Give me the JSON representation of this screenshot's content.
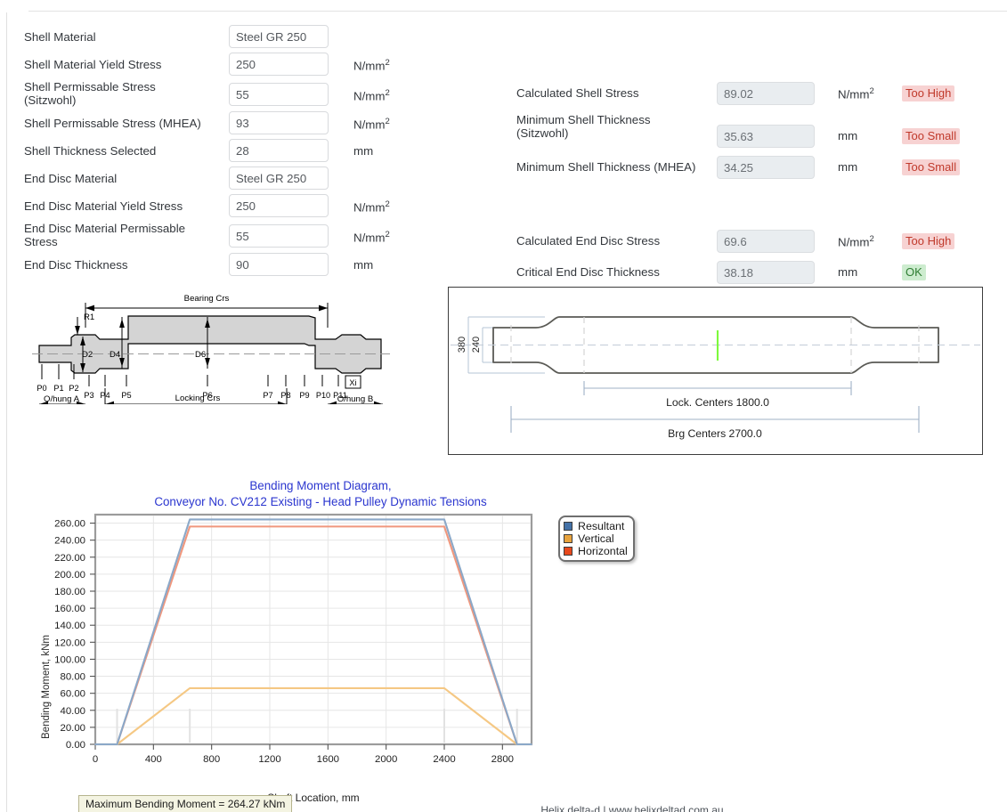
{
  "form_left": {
    "rows": [
      {
        "label": "Shell Material",
        "value": "Steel GR 250",
        "unit": "",
        "unit_sup": "",
        "tall": false
      },
      {
        "label": "Shell Material Yield Stress",
        "value": "250",
        "unit": "N/mm",
        "unit_sup": "2",
        "tall": false
      },
      {
        "label": "Shell Permissable Stress (Sitzwohl)",
        "value": "55",
        "unit": "N/mm",
        "unit_sup": "2",
        "tall": true
      },
      {
        "label": "Shell Permissable Stress (MHEA)",
        "value": "93",
        "unit": "N/mm",
        "unit_sup": "2",
        "tall": false
      },
      {
        "label": "Shell Thickness Selected",
        "value": "28",
        "unit": "mm",
        "unit_sup": "",
        "tall": false
      },
      {
        "label": "End Disc Material",
        "value": "Steel GR 250",
        "unit": "",
        "unit_sup": "",
        "tall": false
      },
      {
        "label": "End Disc Material Yield Stress",
        "value": "250",
        "unit": "N/mm",
        "unit_sup": "2",
        "tall": false
      },
      {
        "label": "End Disc Material Permissable Stress",
        "value": "55",
        "unit": "N/mm",
        "unit_sup": "2",
        "tall": true
      },
      {
        "label": "End Disc Thickness",
        "value": "90",
        "unit": "mm",
        "unit_sup": "",
        "tall": false
      }
    ],
    "label_line_breaks": {
      "shell_permissable_sitzwohl": [
        "Shell Permissable Stress",
        "(Sitzwohl)"
      ],
      "end_disc_permissable": [
        "End Disc Material Permissable",
        "Stress"
      ]
    }
  },
  "results_right": {
    "rows": [
      {
        "label": "Calculated Shell Stress",
        "value": "89.02",
        "unit": "N/mm",
        "unit_sup": "2",
        "status": "Too High",
        "status_kind": "bad",
        "tall": false,
        "gap_before": false
      },
      {
        "label": "Minimum Shell Thickness (Sitzwohl)",
        "value": "35.63",
        "unit": "mm",
        "unit_sup": "",
        "status": "Too Small",
        "status_kind": "bad",
        "tall": true,
        "gap_before": false
      },
      {
        "label": "Minimum Shell Thickness (MHEA)",
        "value": "34.25",
        "unit": "mm",
        "unit_sup": "",
        "status": "Too Small",
        "status_kind": "bad",
        "tall": false,
        "gap_before": false
      },
      {
        "label": "Calculated End Disc Stress",
        "value": "69.6",
        "unit": "N/mm",
        "unit_sup": "2",
        "status": "Too High",
        "status_kind": "bad",
        "tall": false,
        "gap_before": true
      },
      {
        "label": "Critical End Disc Thickness",
        "value": "38.18",
        "unit": "mm",
        "unit_sup": "",
        "status": "OK",
        "status_kind": "ok",
        "tall": false,
        "gap_before": false
      }
    ],
    "label_line_breaks": {
      "min_shell_sitzwohl": [
        "Minimum Shell Thickness",
        "(Sitzwohl)"
      ]
    },
    "status_colors": {
      "bad_text": "#c0392b",
      "bad_bg": "#f7d2d2",
      "ok_text": "#2e7d32",
      "ok_bg": "#cdeccf"
    }
  },
  "shaft_schematic": {
    "dimension_labels": {
      "bearing_crs": "Bearing Crs",
      "locking_crs": "Locking Crs",
      "overhang_a": "O/hung A",
      "overhang_b": "O/hung B",
      "xi": "Xi"
    },
    "diameter_labels": [
      "D2",
      "D4",
      "D6"
    ],
    "radius_label": "R1",
    "point_labels": [
      "P0",
      "P1",
      "P2",
      "P3",
      "P4",
      "P5",
      "P6",
      "P7",
      "P8",
      "P9",
      "P10",
      "P11"
    ]
  },
  "pulley_drawing": {
    "dim_outer_diameter": "380",
    "dim_inner_diameter": "240",
    "dim_locking_centers": "Lock. Centers 1800.0",
    "dim_bearing_centers": "Brg Centers 2700.0",
    "centerline_marker_color": "#7dfa3c"
  },
  "chart_data": {
    "type": "line",
    "title": "Bending Moment Diagram,",
    "subtitle": "Conveyor No. CV212 Existing - Head Pulley Dynamic Tensions",
    "xlabel": "Shaft Location, mm",
    "ylabel": "Bending Moment, kNm",
    "xlim": [
      0,
      3000
    ],
    "ylim": [
      0,
      270
    ],
    "xticks": [
      0,
      400,
      800,
      1200,
      1600,
      2000,
      2400,
      2800
    ],
    "yticks": [
      0.0,
      20.0,
      40.0,
      60.0,
      80.0,
      100.0,
      120.0,
      140.0,
      160.0,
      180.0,
      200.0,
      220.0,
      240.0,
      260.0
    ],
    "ytick_labels": [
      "0.00",
      "20.00",
      "40.00",
      "60.00",
      "80.00",
      "100.00",
      "120.00",
      "140.00",
      "160.00",
      "180.00",
      "200.00",
      "220.00",
      "240.00",
      "260.00"
    ],
    "xtick_labels": [
      "0",
      "400",
      "800",
      "1200",
      "1600",
      "2000",
      "2400",
      "2800"
    ],
    "grid": true,
    "legend_position": "right-outside",
    "series": [
      {
        "name": "Resultant",
        "color": "#4472a8",
        "line_color": "#8ba8c8",
        "x": [
          0,
          150,
          650,
          2400,
          2900,
          3000
        ],
        "values": [
          0,
          0,
          264.27,
          264.27,
          0,
          0
        ]
      },
      {
        "name": "Vertical",
        "color": "#e8a33d",
        "line_color": "#f5c884",
        "x": [
          0,
          150,
          650,
          2400,
          2900,
          3000
        ],
        "values": [
          0,
          0,
          66,
          66,
          0,
          0
        ]
      },
      {
        "name": "Horizontal",
        "color": "#e8491d",
        "line_color": "#f0977d",
        "x": [
          0,
          150,
          650,
          2400,
          2900,
          3000
        ],
        "values": [
          0,
          0,
          256,
          256,
          0,
          0
        ]
      }
    ],
    "annotation_max": "Maximum Bending Moment = 264.27 kNm"
  },
  "footer": {
    "note": "Helix delta-d  |  www.helixdeltad.com.au"
  }
}
